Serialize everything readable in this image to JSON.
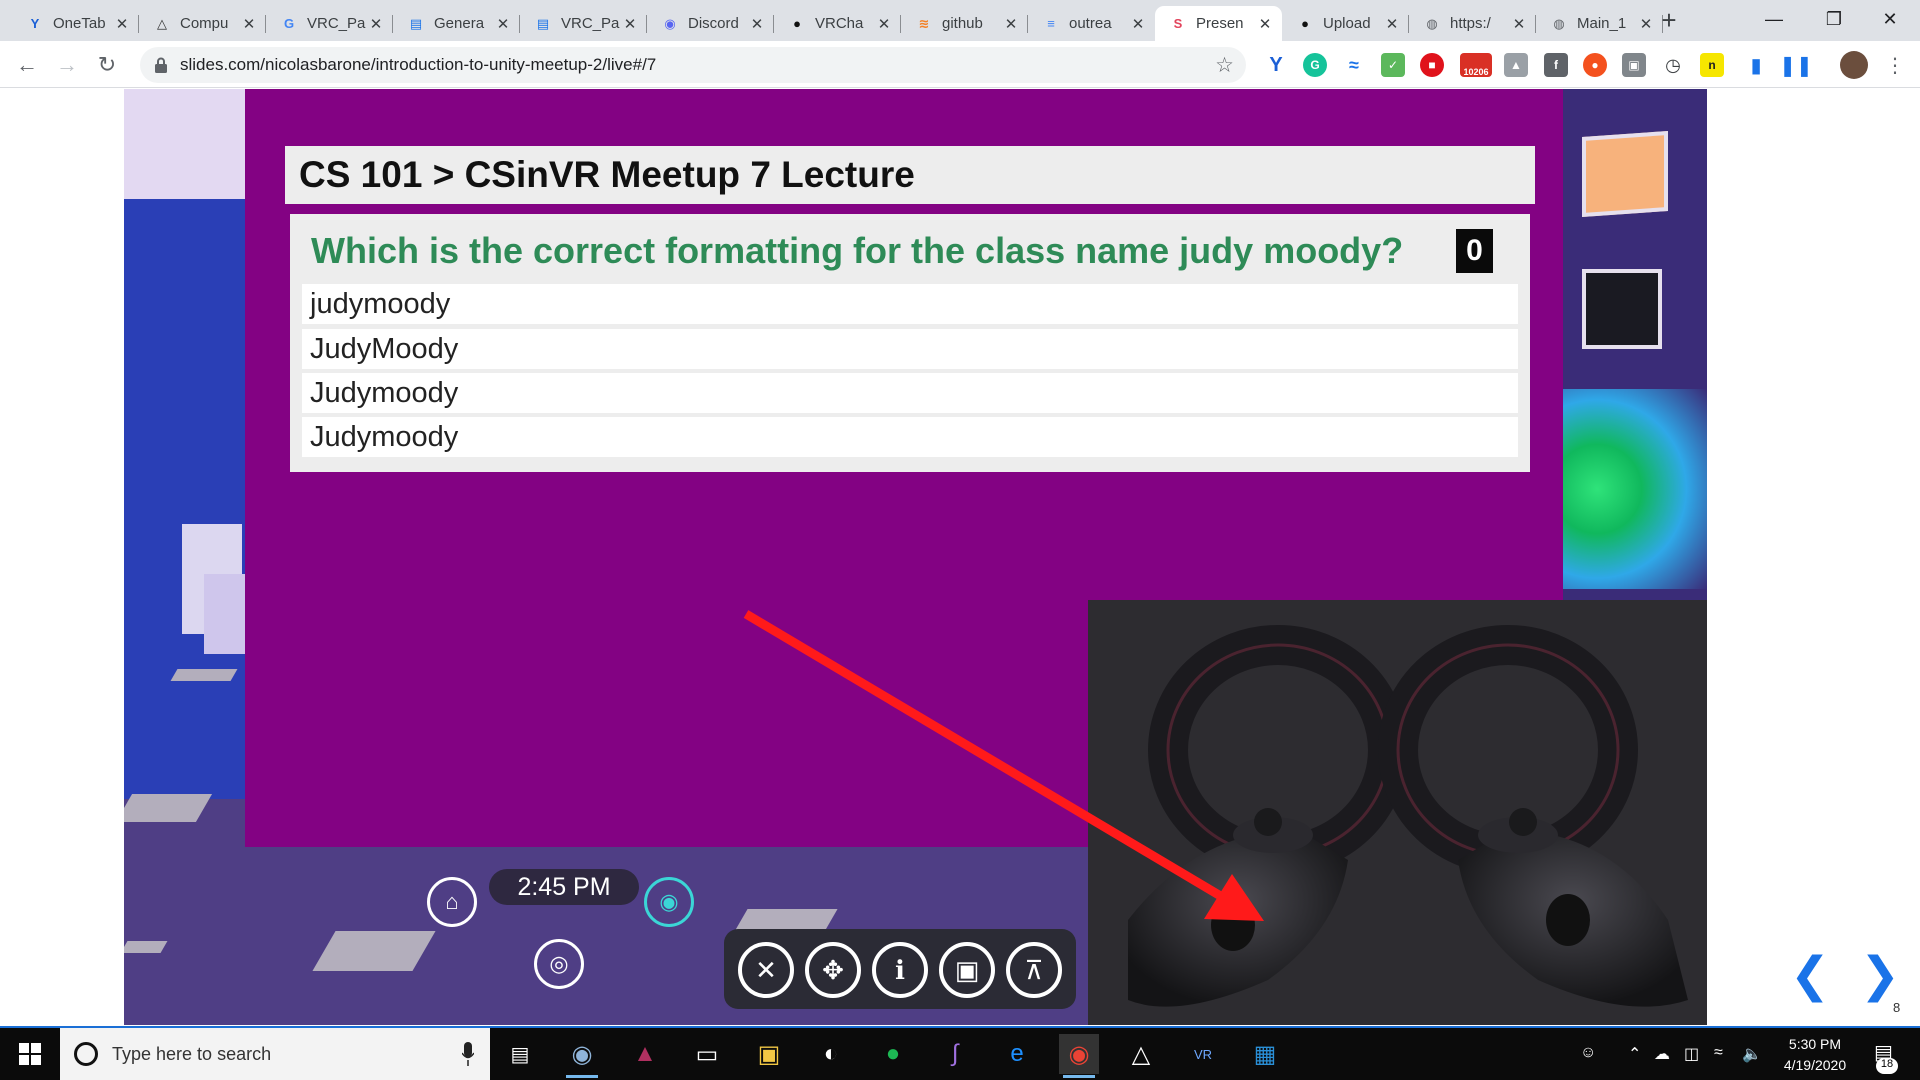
{
  "browser": {
    "tabs": [
      {
        "label": "OneTab",
        "icon": "onetab-icon",
        "color": "#1b5fd6",
        "glyph": "Y"
      },
      {
        "label": "Compu",
        "icon": "triangle-icon",
        "color": "#333333",
        "glyph": "△"
      },
      {
        "label": "VRC_Pa",
        "icon": "google-icon",
        "color": "#4285f4",
        "glyph": "G"
      },
      {
        "label": "Genera",
        "icon": "book-icon",
        "color": "#1a73e8",
        "glyph": "▤"
      },
      {
        "label": "VRC_Pa",
        "icon": "book-icon",
        "color": "#1a73e8",
        "glyph": "▤"
      },
      {
        "label": "Discord",
        "icon": "discord-icon",
        "color": "#5865f2",
        "glyph": "◉"
      },
      {
        "label": "VRCha",
        "icon": "github-icon",
        "color": "#111111",
        "glyph": "●"
      },
      {
        "label": "github",
        "icon": "stackoverflow-icon",
        "color": "#f48024",
        "glyph": "≋"
      },
      {
        "label": "outrea",
        "icon": "docs-icon",
        "color": "#4285f4",
        "glyph": "≡"
      },
      {
        "label": "Presen",
        "icon": "slides-icon",
        "color": "#e2445c",
        "glyph": "S"
      },
      {
        "label": "Upload",
        "icon": "github-icon",
        "color": "#111111",
        "glyph": "●"
      },
      {
        "label": "https:/",
        "icon": "globe-icon",
        "color": "#5f6368",
        "glyph": "◍"
      },
      {
        "label": "Main_1",
        "icon": "globe-icon",
        "color": "#5f6368",
        "glyph": "◍"
      }
    ],
    "active_tab_index": 9,
    "url": "slides.com/nicolasbarone/introduction-to-unity-meetup-2/live#/7",
    "extensions_badge": "10206"
  },
  "slide": {
    "title": "CS 101 > CSinVR Meetup 7 Lecture",
    "question": "Which is the correct formatting for the class name judy moody?",
    "answer_count": "0",
    "options": [
      "judymoody",
      "JudyMoody",
      "Judymoody",
      "Judymoody"
    ],
    "hud_time": "2:45 PM",
    "page_number": "8"
  },
  "taskbar": {
    "search_placeholder": "Type here to search",
    "clock_time": "5:30 PM",
    "clock_date": "4/19/2020",
    "notification_count": "18"
  }
}
